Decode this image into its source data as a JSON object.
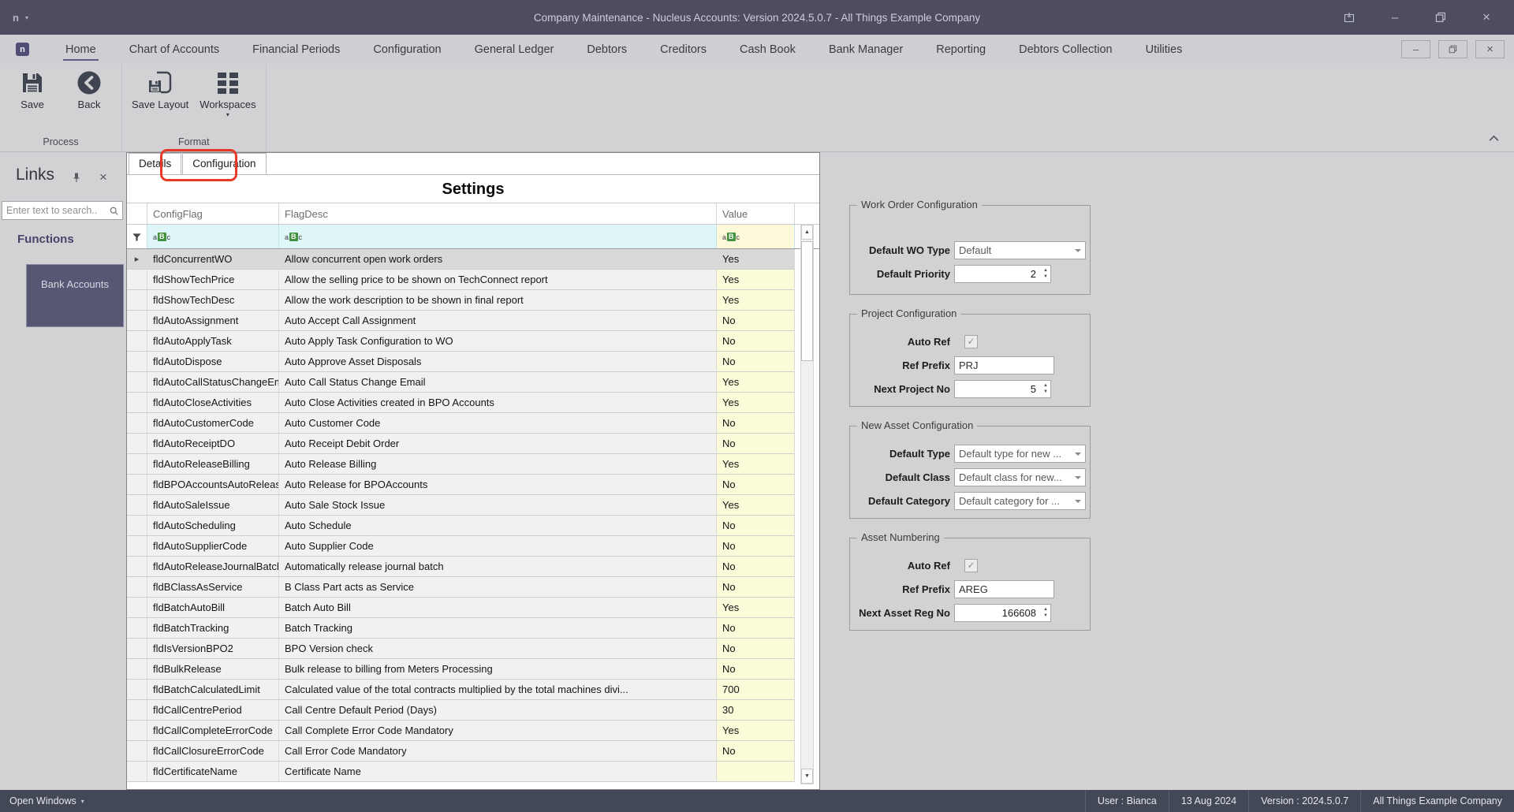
{
  "title_bar": {
    "title": "Company Maintenance - Nucleus Accounts: Version 2024.5.0.7 - All Things Example Company",
    "logo_text": "n"
  },
  "ribbon": {
    "tabs": [
      "Home",
      "Chart of Accounts",
      "Financial Periods",
      "Configuration",
      "General Ledger",
      "Debtors",
      "Creditors",
      "Cash Book",
      "Bank Manager",
      "Reporting",
      "Debtors Collection",
      "Utilities"
    ],
    "active_tab": "Home",
    "groups": [
      {
        "label": "Process",
        "buttons": [
          {
            "label": "Save",
            "icon": "save-icon"
          },
          {
            "label": "Back",
            "icon": "back-icon"
          }
        ]
      },
      {
        "label": "Format",
        "buttons": [
          {
            "label": "Save Layout",
            "icon": "save-layout-icon"
          },
          {
            "label": "Workspaces",
            "icon": "workspaces-icon",
            "has_dropdown": true
          }
        ]
      }
    ]
  },
  "links_panel": {
    "title": "Links",
    "search_placeholder": "Enter text to search..",
    "section_header": "Functions",
    "items": [
      {
        "label": "Bank Accounts",
        "selected": true
      }
    ]
  },
  "settings_panel": {
    "tabs": [
      "Details",
      "Configuration"
    ],
    "active_tab": "Configuration",
    "annotated_tab": "Configuration",
    "title": "Settings",
    "grid": {
      "columns": [
        "ConfigFlag",
        "FlagDesc",
        "Value"
      ],
      "rows": [
        {
          "flag": "fldConcurrentWO",
          "desc": "Allow concurrent open work orders",
          "value": "Yes",
          "selected": true
        },
        {
          "flag": "fldShowTechPrice",
          "desc": "Allow the selling price to be shown on TechConnect report",
          "value": "Yes"
        },
        {
          "flag": "fldShowTechDesc",
          "desc": "Allow the work description to be shown in final report",
          "value": "Yes"
        },
        {
          "flag": "fldAutoAssignment",
          "desc": "Auto Accept Call Assignment",
          "value": "No"
        },
        {
          "flag": "fldAutoApplyTask",
          "desc": "Auto Apply Task Configuration to WO",
          "value": "No"
        },
        {
          "flag": "fldAutoDispose",
          "desc": "Auto Approve Asset Disposals",
          "value": "No"
        },
        {
          "flag": "fldAutoCallStatusChangeEmail",
          "desc": "Auto Call Status Change Email",
          "value": "Yes"
        },
        {
          "flag": "fldAutoCloseActivities",
          "desc": "Auto Close Activities created in BPO Accounts",
          "value": "Yes"
        },
        {
          "flag": "fldAutoCustomerCode",
          "desc": "Auto Customer Code",
          "value": "No"
        },
        {
          "flag": "fldAutoReceiptDO",
          "desc": "Auto Receipt Debit Order",
          "value": "No"
        },
        {
          "flag": "fldAutoReleaseBilling",
          "desc": "Auto Release Billing",
          "value": "Yes"
        },
        {
          "flag": "fldBPOAccountsAutoRelease",
          "desc": "Auto Release for BPOAccounts",
          "value": "No"
        },
        {
          "flag": "fldAutoSaleIssue",
          "desc": "Auto Sale Stock Issue",
          "value": "Yes"
        },
        {
          "flag": "fldAutoScheduling",
          "desc": "Auto Schedule",
          "value": "No"
        },
        {
          "flag": "fldAutoSupplierCode",
          "desc": "Auto Supplier Code",
          "value": "No"
        },
        {
          "flag": "fldAutoReleaseJournalBatch",
          "desc": "Automatically release journal batch",
          "value": "No"
        },
        {
          "flag": "fldBClassAsService",
          "desc": "B Class Part acts as Service",
          "value": "No"
        },
        {
          "flag": "fldBatchAutoBill",
          "desc": "Batch Auto Bill",
          "value": "Yes"
        },
        {
          "flag": "fldBatchTracking",
          "desc": "Batch Tracking",
          "value": "No"
        },
        {
          "flag": "fldIsVersionBPO2",
          "desc": "BPO Version check",
          "value": "No"
        },
        {
          "flag": "fldBulkRelease",
          "desc": "Bulk release to billing from Meters Processing",
          "value": "No"
        },
        {
          "flag": "fldBatchCalculatedLimit",
          "desc": "Calculated value of the total contracts multiplied by the total machines divi...",
          "value": "700"
        },
        {
          "flag": "fldCallCentrePeriod",
          "desc": "Call Centre Default Period (Days)",
          "value": "30"
        },
        {
          "flag": "fldCallCompleteErrorCode",
          "desc": "Call Complete Error Code Mandatory",
          "value": "Yes"
        },
        {
          "flag": "fldCallClosureErrorCode",
          "desc": "Call Error Code Mandatory",
          "value": "No"
        },
        {
          "flag": "fldCertificateName",
          "desc": "Certificate Name",
          "value": ""
        }
      ]
    }
  },
  "config_groups": [
    {
      "legend": "Work Order Configuration",
      "fields": [
        {
          "label": "Default WO Type",
          "type": "select",
          "value": "Default"
        },
        {
          "label": "Default Priority",
          "type": "spinner",
          "value": "2"
        }
      ]
    },
    {
      "legend": "Project Configuration",
      "fields": [
        {
          "label": "Auto Ref",
          "type": "checkbox",
          "checked": true
        },
        {
          "label": "Ref Prefix",
          "type": "text",
          "value": "PRJ"
        },
        {
          "label": "Next Project No",
          "type": "spinner",
          "value": "5"
        }
      ]
    },
    {
      "legend": "New Asset Configuration",
      "fields": [
        {
          "label": "Default Type",
          "type": "select",
          "value": "Default type for new ..."
        },
        {
          "label": "Default Class",
          "type": "select",
          "value": "Default class for new..."
        },
        {
          "label": "Default Category",
          "type": "select",
          "value": "Default category for ..."
        }
      ]
    },
    {
      "legend": "Asset Numbering",
      "fields": [
        {
          "label": "Auto Ref",
          "type": "checkbox",
          "checked": true
        },
        {
          "label": "Ref Prefix",
          "type": "text",
          "value": "AREG"
        },
        {
          "label": "Next Asset Reg No",
          "type": "spinner",
          "value": "166608"
        }
      ]
    }
  ],
  "status_bar": {
    "open_windows_label": "Open Windows",
    "items": [
      "User : Bianca",
      "13 Aug 2024",
      "Version : 2024.5.0.7",
      "All Things Example Company"
    ]
  },
  "icons": {
    "filter_cell": "funnel-icon",
    "text_filter": "abc-filter-icon",
    "selected_row_marker": "arrow-right-icon",
    "search": "magnifier-icon",
    "panel_pin": "pin-icon"
  },
  "colors": {
    "titlebar": "#4d4c60",
    "statusbar": "#434857",
    "selected_tile": "#575673",
    "annotation_red": "#e63a29",
    "filter_row": "#def6f8",
    "value_column": "#fbfad9",
    "selected_row": "#d9d9d9",
    "abc_green": "#41913f"
  }
}
